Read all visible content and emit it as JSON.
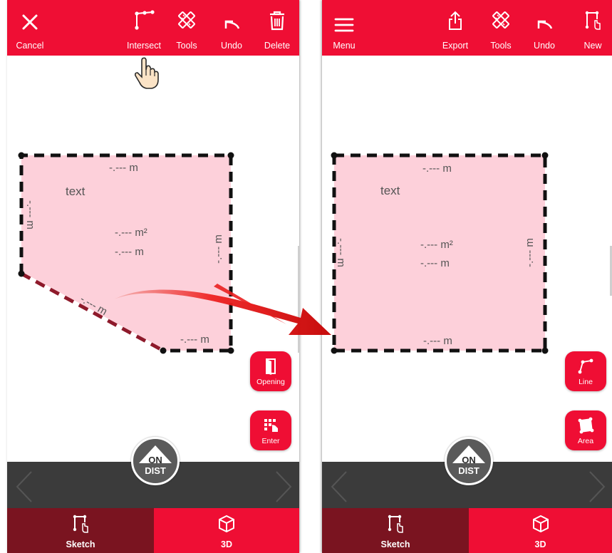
{
  "left_screen": {
    "toolbar": {
      "cancel": "Cancel",
      "intersect": "Intersect",
      "tools": "Tools",
      "undo": "Undo",
      "delete": "Delete"
    },
    "sketch": {
      "note": "text",
      "top_dim": "-.--- m",
      "left_dim": "-.--- m",
      "area": "-.--- m²",
      "perimeter": "-.--- m",
      "right_dim": "-.--- m",
      "diagonal_dim": "-.--- m",
      "bottom_dim": "-.--- m"
    },
    "fabs": {
      "opening": "Opening",
      "enter": "Enter"
    },
    "ondist": {
      "top": "ON",
      "bottom": "DIST"
    },
    "tabs": {
      "sketch": "Sketch",
      "three_d": "3D"
    }
  },
  "right_screen": {
    "toolbar": {
      "menu": "Menu",
      "export": "Export",
      "tools": "Tools",
      "undo": "Undo",
      "new": "New"
    },
    "sketch": {
      "note": "text",
      "top_dim": "-.--- m",
      "left_dim": "-.--- m",
      "area": "-.--- m²",
      "perimeter": "-.--- m",
      "right_dim": "-.--- m",
      "bottom_dim": "-.--- m"
    },
    "fabs": {
      "line": "Line",
      "area": "Area"
    },
    "ondist": {
      "top": "ON",
      "bottom": "DIST"
    },
    "tabs": {
      "sketch": "Sketch",
      "three_d": "3D"
    }
  },
  "colors": {
    "accent": "#ef0e34",
    "sketch_tab_active": "#7a1420",
    "shape_fill": "#fdd0da",
    "dark_bar": "#3b3b3b"
  }
}
